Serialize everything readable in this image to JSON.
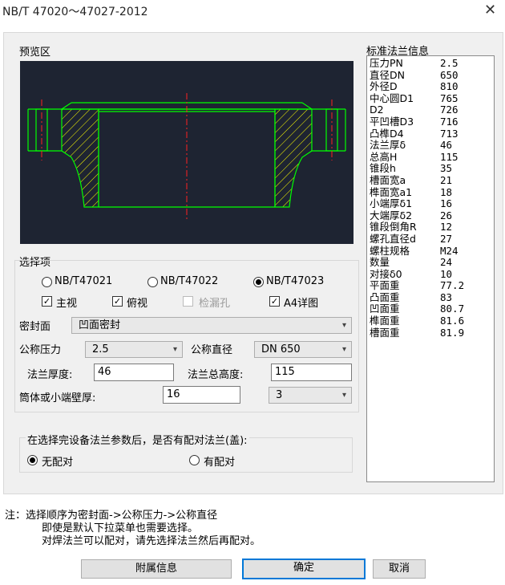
{
  "window": {
    "title": "NB/T 47020～47027-2012"
  },
  "preview": {
    "label": "预览区"
  },
  "options": {
    "label": "选择项",
    "standards": [
      {
        "label": "NB/T47021",
        "selected": false
      },
      {
        "label": "NB/T47022",
        "selected": false
      },
      {
        "label": "NB/T47023",
        "selected": true
      }
    ],
    "views": [
      {
        "label": "主视",
        "checked": true,
        "enabled": true
      },
      {
        "label": "俯视",
        "checked": true,
        "enabled": true
      },
      {
        "label": "检漏孔",
        "checked": false,
        "enabled": false
      },
      {
        "label": "A4详图",
        "checked": true,
        "enabled": true
      }
    ],
    "seal_face_label": "密封面",
    "seal_face_value": "凹面密封",
    "pressure_label": "公称压力",
    "pressure_value": "2.5",
    "diameter_label": "公称直径",
    "diameter_value": "DN 650",
    "thickness_label": "法兰厚度:",
    "thickness_value": "46",
    "height_label": "法兰总高度:",
    "height_value": "115",
    "wall_label": "筒体或小端壁厚:",
    "wall_value": "16",
    "wall_combo_value": "3"
  },
  "mating": {
    "question": "在选择完设备法兰参数后，是否有配对法兰(盖):",
    "no_label": "无配对",
    "yes_label": "有配对",
    "selected": "no"
  },
  "info": {
    "label": "标准法兰信息",
    "rows": [
      {
        "k": "压力PN",
        "v": "2.5"
      },
      {
        "k": "直径DN",
        "v": "650"
      },
      {
        "k": "外径D",
        "v": "810"
      },
      {
        "k": "中心圆D1",
        "v": "765"
      },
      {
        "k": "D2",
        "v": " 726"
      },
      {
        "k": "平凹槽D3",
        "v": "716"
      },
      {
        "k": "凸榫D4",
        "v": "713"
      },
      {
        "k": "法兰厚δ",
        "v": "46"
      },
      {
        "k": "总高H",
        "v": "115"
      },
      {
        "k": "锥段h",
        "v": "35"
      },
      {
        "k": "槽面宽a",
        "v": "21"
      },
      {
        "k": "榫面宽a1",
        "v": "18"
      },
      {
        "k": "小端厚δ1",
        "v": "16"
      },
      {
        "k": "大端厚δ2",
        "v": "26"
      },
      {
        "k": "锥段倒角R",
        "v": "12"
      },
      {
        "k": "螺孔直径d",
        "v": "27"
      },
      {
        "k": "螺柱规格",
        "v": "M24"
      },
      {
        "k": "数量",
        "v": "24"
      },
      {
        "k": "对接δ0",
        "v": "10"
      },
      {
        "k": "平面重",
        "v": "77.2"
      },
      {
        "k": "凸面重",
        "v": "83"
      },
      {
        "k": "凹面重",
        "v": "80.7"
      },
      {
        "k": "榫面重",
        "v": "81.6"
      },
      {
        "k": "槽面重",
        "v": "81.9"
      }
    ]
  },
  "notes": [
    "注：选择顺序为密封面->公称压力->公称直径",
    "即使是默认下拉菜单也需要选择。",
    "对焊法兰可以配对，请先选择法兰然后再配对。"
  ],
  "buttons": {
    "attach": "附属信息",
    "ok": "确定",
    "cancel": "取消"
  },
  "colors": {
    "drawing_bg": "#1e2432",
    "outline": "#00ff00",
    "hatch": "#ffff00",
    "centerline": "#ff2020"
  }
}
